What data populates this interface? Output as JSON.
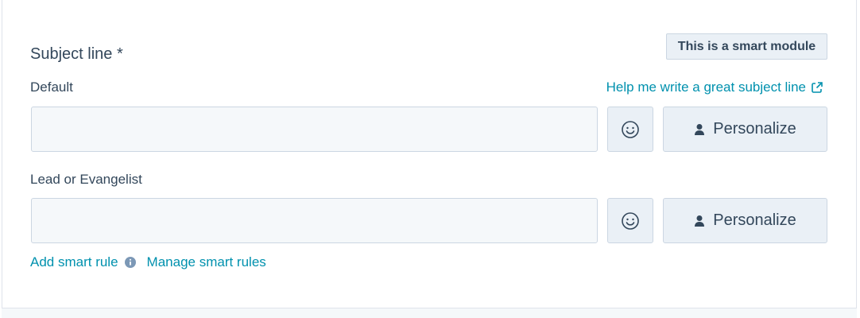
{
  "section": {
    "title": "Subject line *",
    "badge": "This is a smart module"
  },
  "default_field": {
    "label": "Default",
    "value": "",
    "help_link": "Help me write a great subject line",
    "personalize_label": "Personalize"
  },
  "lead_field": {
    "label": "Lead or Evangelist",
    "value": "",
    "personalize_label": "Personalize"
  },
  "footer_links": {
    "add_rule": "Add smart rule",
    "manage_rules": "Manage smart rules"
  },
  "icons": {
    "emoji": "smiley-face-icon",
    "personalize": "person-icon",
    "external": "external-link-icon",
    "info": "info-icon"
  },
  "colors": {
    "text": "#33475b",
    "link": "#0091ae",
    "input_bg": "#f5f8fa",
    "button_bg": "#eaf0f6",
    "border": "#cbd6e2"
  }
}
